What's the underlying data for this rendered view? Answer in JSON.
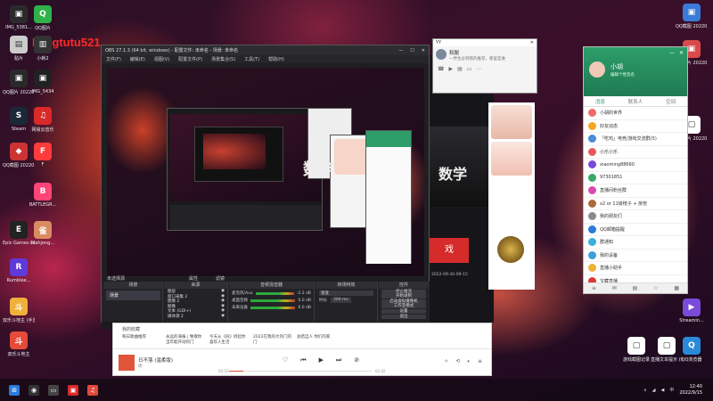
{
  "watermark": "Mingtutu521",
  "desktop_icons_left": [
    {
      "label": "IMG_5381...",
      "color": "#2a2a2a",
      "glyph": "▣"
    },
    {
      "label": "QQ图片",
      "color": "#2fb24a",
      "glyph": "Q"
    },
    {
      "label": "贴片",
      "color": "#cccccc",
      "glyph": "▤"
    },
    {
      "label": "小耗2",
      "color": "#333333",
      "glyph": "▥"
    },
    {
      "label": "QQ图片 20220...",
      "color": "#2a2a2a",
      "glyph": "▣"
    },
    {
      "label": "IMG_5434",
      "color": "#222222",
      "glyph": "▣"
    },
    {
      "label": "Steam",
      "color": "#1b2838",
      "glyph": "S"
    },
    {
      "label": "网易云音乐",
      "color": "#d92a2a",
      "glyph": "♫"
    },
    {
      "label": "QQ截图 20220...",
      "color": "#cc3333",
      "glyph": "◆"
    },
    {
      "label": "F",
      "color": "#ff3b3b",
      "glyph": "F"
    },
    {
      "label": "BATTLEGR...",
      "color": "#ff4477",
      "glyph": "B"
    },
    {
      "label": "Epic Games Launcher",
      "color": "#222222",
      "glyph": "E"
    },
    {
      "label": "Mahjong...",
      "color": "#d98c5f",
      "glyph": "雀"
    },
    {
      "label": "Rumblee...",
      "color": "#5f3ad9",
      "glyph": "R"
    },
    {
      "label": "双乐斗地主 (手游电脑版)",
      "color": "#f0b03a",
      "glyph": "斗"
    },
    {
      "label": "双乐斗地主",
      "color": "#e64a3a",
      "glyph": "斗"
    }
  ],
  "desktop_icons_right": [
    {
      "label": "QQ截图 20220...",
      "color": "#3a7ad9",
      "glyph": "▣"
    },
    {
      "label": "QQ图片 20220...",
      "color": "#d94a4a",
      "glyph": "▣"
    },
    {
      "label": "QQ图片 20220...",
      "color": "#ffffff",
      "glyph": "▢"
    },
    {
      "label": "Streamin...",
      "color": "#7a4ad9",
      "glyph": "▶"
    },
    {
      "label": "QQ浏览器",
      "color": "#2a8ad9",
      "glyph": "Q"
    },
    {
      "label": "直播文本提示 (修改)",
      "color": "#ffffff",
      "glyph": "▢"
    },
    {
      "label": "游戏截图记录",
      "color": "#ffffff",
      "glyph": "▢"
    }
  ],
  "obs": {
    "title": "OBS 27.1.3 (64 bit, windows) - 配置文件: 未命名 - 场景: 未命名",
    "menu": [
      "文件(F)",
      "编辑(E)",
      "视图(V)",
      "配置文件(P)",
      "场景集合(S)",
      "工具(T)",
      "帮助(H)"
    ],
    "scene_label": "未选择源",
    "properties_label": "属性",
    "filters_label": "滤镜",
    "docks": {
      "scenes_title": "场景",
      "scenes_value": "场景",
      "sources_title": "来源",
      "sources": [
        "图层",
        "窗口采集 2",
        "图像 2",
        "图像",
        "文本 (GDI+)",
        "媒体源 2"
      ],
      "mixer_title": "音频混音器",
      "mixer": [
        {
          "name": "麦克风/Aux",
          "db": "-2.2 dB"
        },
        {
          "name": "桌面音频",
          "db": "0.0 dB"
        },
        {
          "name": "未来设备",
          "db": "0.0 dB"
        }
      ],
      "transitions_title": "转场特效",
      "transition_value": "渐变",
      "duration_label": "时长",
      "duration_value": "300 ms",
      "controls_title": "控件",
      "controls": [
        "停止推流",
        "开始录制",
        "启动虚拟摄像机",
        "工作室模式",
        "设置",
        "退出"
      ]
    },
    "status": {
      "drop": "丢帧 0 (0.0%)",
      "live": "LIVE: 00:00:00",
      "rec": "REC: 00:00:00",
      "cpu": "CPU: 0.9%, 60.00 fps"
    }
  },
  "stream_title": "数学",
  "yy_chat": {
    "title": "YY",
    "name": "和腿",
    "message": "一界生必到我的推荐，那里是谁"
  },
  "stream_panel": {
    "room_id": "2022-09-30-09-15",
    "button_label": "戏"
  },
  "qq": {
    "name": "小胡",
    "status": "编辑个性签名",
    "tabs": [
      "消息",
      "联系人",
      "空间"
    ],
    "items": [
      {
        "name": "小胡的世界",
        "color": "#f06a6a",
        "time": ""
      },
      {
        "name": "好友动态",
        "color": "#f5a623",
        "time": ""
      },
      {
        "name": "「吃鸡」电竞/游戏交流群(5)",
        "color": "#4a8ad9",
        "time": ""
      },
      {
        "name": "小乐小乐",
        "color": "#e85a5a",
        "time": ""
      },
      {
        "name": "xiaoming88660",
        "color": "#7a4ad9",
        "time": ""
      },
      {
        "name": "97301851",
        "color": "#3aa86a",
        "time": ""
      },
      {
        "name": "直播间粉丝群",
        "color": "#d94ab0",
        "time": ""
      },
      {
        "name": "x2 or 11级榜子 + 房管",
        "color": "#aa6a3a",
        "time": ""
      },
      {
        "name": "我的朋友们",
        "color": "#8a8a8a",
        "time": ""
      },
      {
        "name": "QQ邮箱提醒",
        "color": "#2a7ad9",
        "time": ""
      },
      {
        "name": "群通知",
        "color": "#3ab0d9",
        "time": ""
      },
      {
        "name": "我的设备",
        "color": "#3aa0d9",
        "time": ""
      },
      {
        "name": "直播小助手",
        "color": "#f0b03a",
        "time": ""
      },
      {
        "name": "宝藏直播",
        "color": "#d93a3a",
        "time": ""
      }
    ]
  },
  "music": {
    "tab_label": "我的收藏",
    "items": [
      "每日歌曲推荐",
      "永远的海报 | 致敬你当年能开动的门",
      "今天从《同》听起你喜欢人生活",
      "2022在我的大热门的门",
      "总结自人 你们的家"
    ],
    "song": "日不落 (温柔版)",
    "artist": "杨",
    "time_current": "00:16",
    "time_total": "02:42",
    "progress": 0.1
  },
  "taskbar": {
    "time": "12:40",
    "date": "2022/9/15"
  }
}
